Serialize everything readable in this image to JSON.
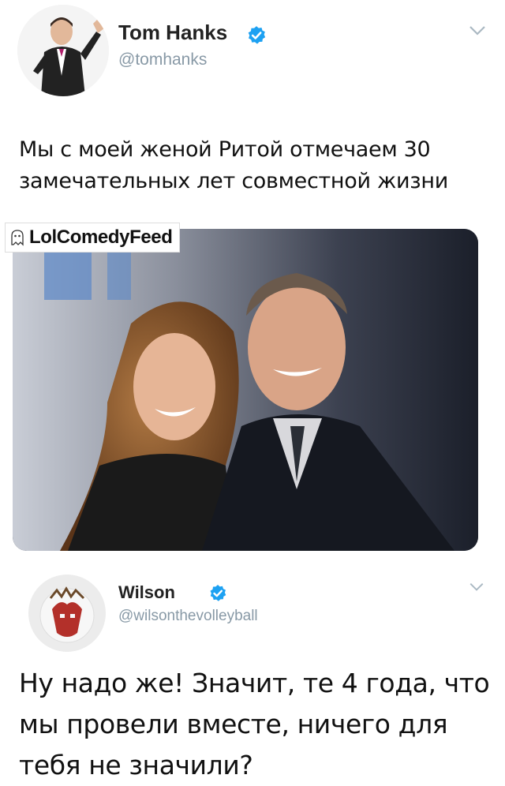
{
  "tweet": {
    "author_name": "Tom Hanks",
    "author_handle": "@tomhanks",
    "text": "Мы с моей женой Ритой отмечаем 30 замечательных лет совместной жизни",
    "verified_icon": "verified-badge-icon",
    "menu_icon": "chevron-down-icon"
  },
  "photo": {
    "watermark": "LolComedyFeed"
  },
  "reply": {
    "author_name": "Wilson",
    "author_handle": "@wilsonthevolleyball",
    "text": "Ну надо же! Значит, те 4 года, что мы провели вместе, ничего для тебя не значили?",
    "verified_icon": "verified-badge-icon",
    "menu_icon": "chevron-down-icon"
  },
  "colors": {
    "verified_blue": "#1da1f2",
    "handle_gray": "#8899a6"
  }
}
